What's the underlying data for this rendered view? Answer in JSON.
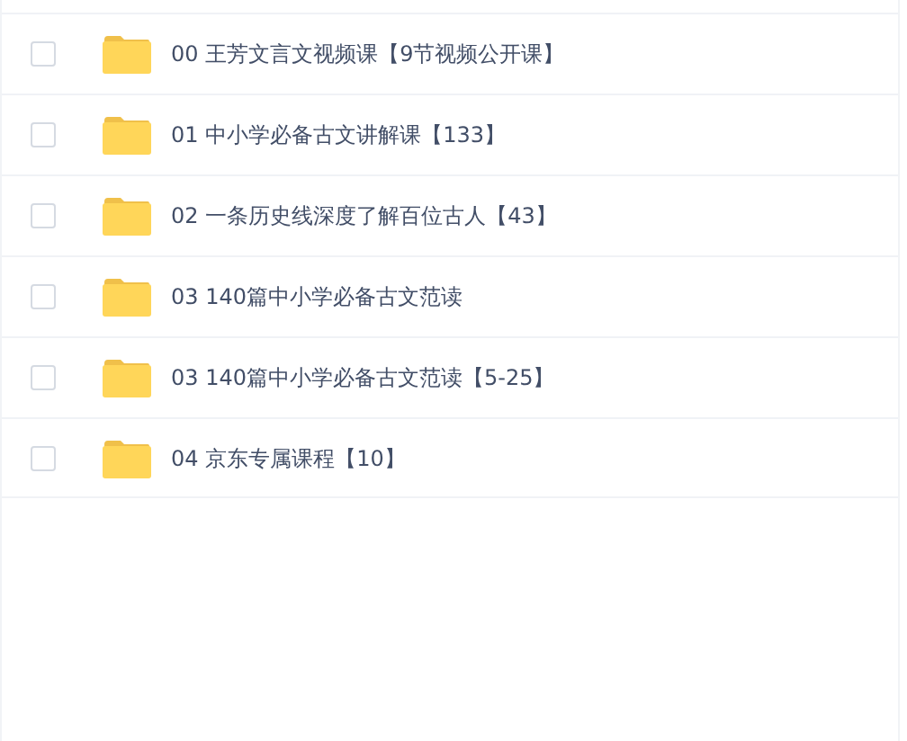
{
  "files": [
    {
      "name": "00 王芳文言文视频课【9节视频公开课】",
      "checked": false
    },
    {
      "name": "01 中小学必备古文讲解课【133】",
      "checked": false
    },
    {
      "name": "02 一条历史线深度了解百位古人【43】",
      "checked": false
    },
    {
      "name": "03 140篇中小学必备古文范读",
      "checked": false
    },
    {
      "name": "03 140篇中小学必备古文范读【5-25】",
      "checked": false
    },
    {
      "name": "04 京东专属课程【10】",
      "checked": false
    }
  ]
}
